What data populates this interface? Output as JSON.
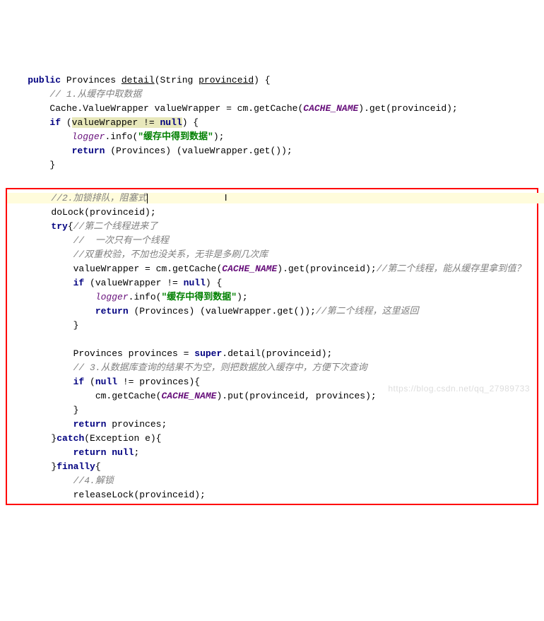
{
  "colors": {
    "keyword": "#000080",
    "comment": "#808080",
    "string": "#008000",
    "param": "#660e7a",
    "highlight": "#e8e8bb",
    "rowHighlight": "#fffcdc",
    "boxBorder": "#ff0000"
  },
  "watermark": "https://blog.csdn.net/qq_27989733",
  "sig": {
    "public": "public",
    "ret": "Provinces",
    "name": "detail",
    "ptype": "String",
    "pname": "provinceid"
  },
  "c1": "// 1.从缓存中取数据",
  "l2a": "Cache.ValueWrapper valueWrapper = cm.getCache(",
  "cache_name": "CACHE_NAME",
  "l2b": ").get(provinceid);",
  "l3a": "if",
  "l3b": " (",
  "l3c": "valueWrapper != ",
  "l3d": "null",
  "l3e": ") {",
  "l4a": "logger",
  "l4b": ".info(",
  "l4c": "\"缓存中得到数据\"",
  "l4d": ");",
  "l5a": "return",
  "l5b": " (Provinces) (valueWrapper.get());",
  "rbrace": "}",
  "c2": "//2.加锁排队，阻塞式",
  "l7a": "doLock(provinceid);",
  "l8a": "try",
  "l8b": "{",
  "c8": "//第二个线程进来了",
  "c9": "//  一次只有一个线程",
  "c10": "//双重校验，不加也没关系，无非是多刷几次库",
  "l11a": "valueWrapper = cm.getCache(",
  "l11b": ").get(provinceid);",
  "c11": "//第二个线程，能从缓存里拿到值？",
  "l12a": "if",
  "l12b": " (valueWrapper != ",
  "l12c": "null",
  "l12d": ") {",
  "l13a": "logger",
  "l13b": ".info(",
  "l13s": "\"缓存中得到数据\"",
  "l13c": ");",
  "l14a": "return",
  "l14b": " (Provinces) (valueWrapper.get());",
  "c14": "//第二个线程，这里返回",
  "l16a": "Provinces provinces = ",
  "l16b": "super",
  "l16c": ".detail(provinceid);",
  "c17": "// 3.从数据库查询的结果不为空，则把数据放入缓存中，方便下次查询",
  "l18a": "if",
  "l18b": " (",
  "l18c": "null",
  "l18d": " != provinces){",
  "l19a": "cm.getCache(",
  "l19b": ").put(provinceid, provinces);",
  "l20a": "return",
  "l20b": " provinces;",
  "l21a": "}",
  "l21b": "catch",
  "l21c": "(Exception e){",
  "l22a": "return null",
  "l22b": ";",
  "l23a": "}",
  "l23b": "finally",
  "l23c": "{",
  "c24": "//4.解锁",
  "l25": "releaseLock(provinceid);"
}
